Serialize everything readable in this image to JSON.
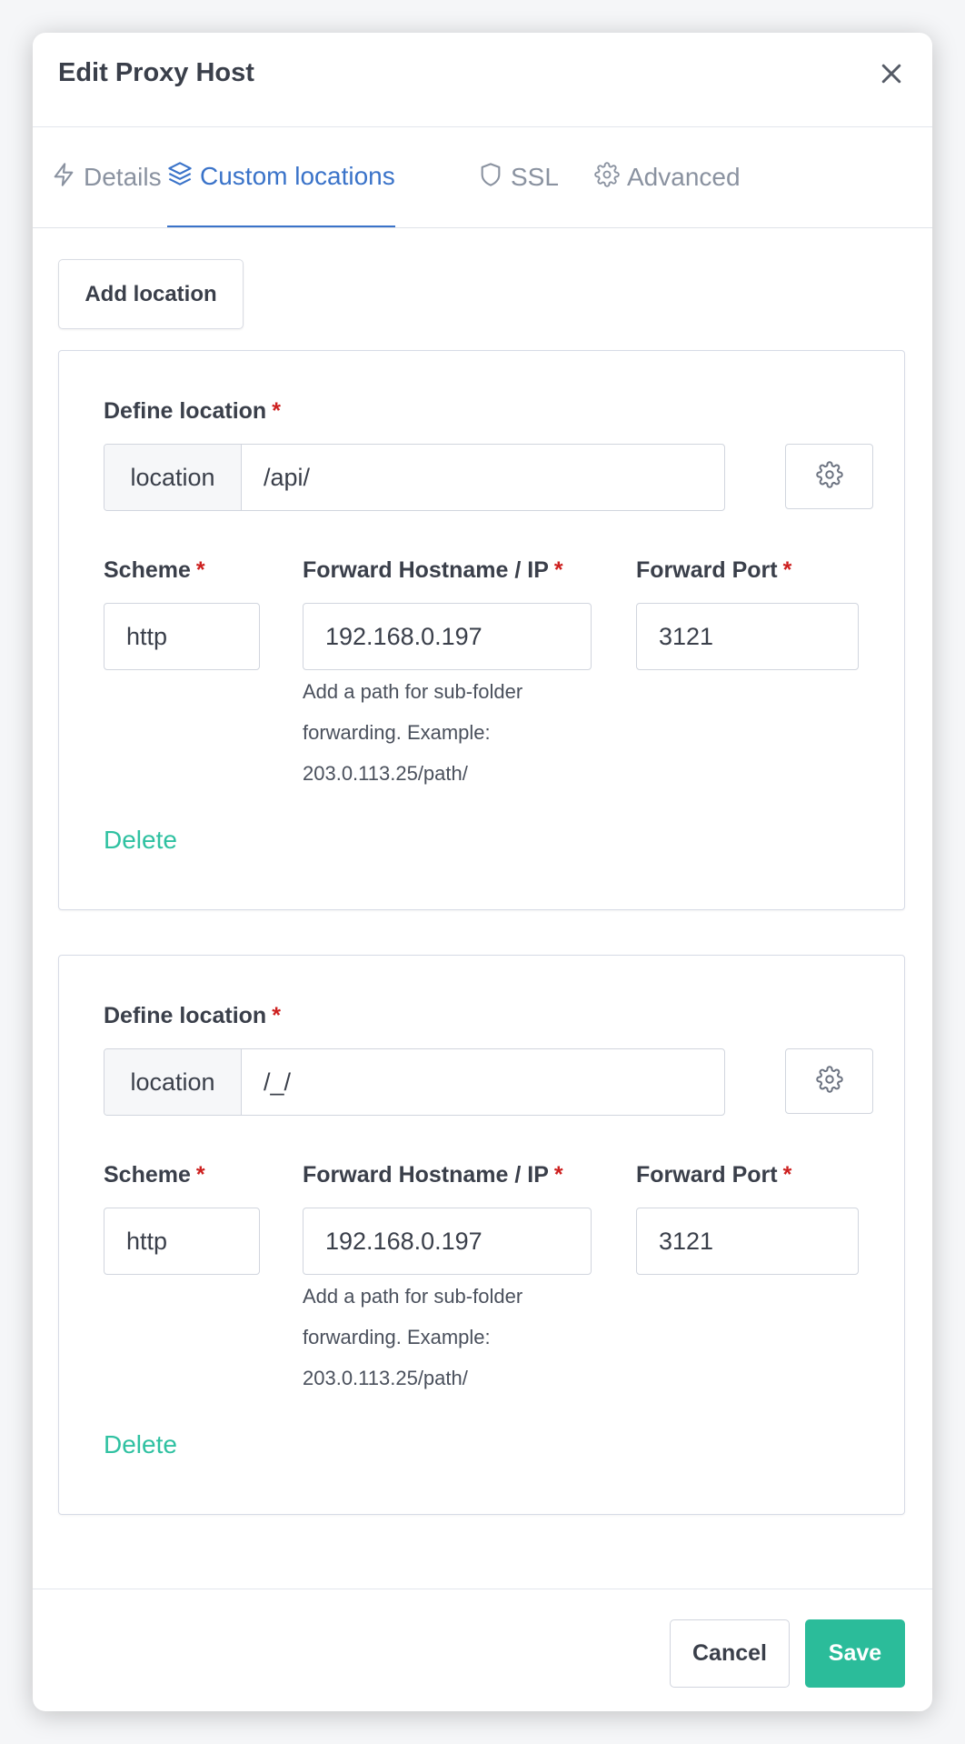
{
  "modal": {
    "title": "Edit Proxy Host"
  },
  "tabs": [
    {
      "label": "Details",
      "icon": "bolt-icon",
      "active": false
    },
    {
      "label": "Custom locations",
      "icon": "layers-icon",
      "active": true
    },
    {
      "label": "SSL",
      "icon": "shield-icon",
      "active": false
    },
    {
      "label": "Advanced",
      "icon": "gear-icon",
      "active": false
    }
  ],
  "add_location_label": "Add location",
  "labels": {
    "define_location": "Define location",
    "location_addon": "location",
    "scheme": "Scheme",
    "forward_host": "Forward Hostname / IP",
    "forward_port": "Forward Port",
    "required_mark": "*",
    "help_text": "Add a path for sub-folder forwarding. Example: 203.0.113.25/path/",
    "delete": "Delete"
  },
  "locations": [
    {
      "path": "/api/",
      "scheme": "http",
      "host": "192.168.0.197",
      "port": "3121"
    },
    {
      "path": "/_/",
      "scheme": "http",
      "host": "192.168.0.197",
      "port": "3121"
    }
  ],
  "footer": {
    "cancel_label": "Cancel",
    "save_label": "Save"
  },
  "colors": {
    "accent": "#3a73c9",
    "save": "#2bbc9a",
    "delete": "#2fc1a1",
    "required": "#cd201f"
  }
}
